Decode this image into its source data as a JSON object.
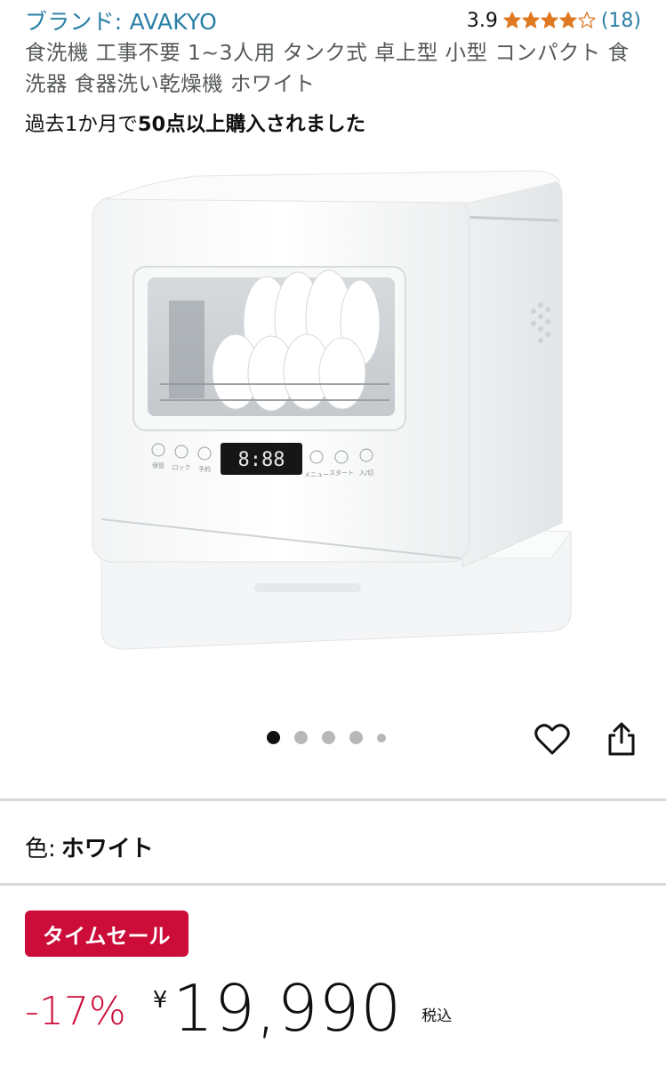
{
  "brand": {
    "link_text": "ブランド: AVAKYO"
  },
  "rating": {
    "value": "3.9",
    "stars_filled": 3.9,
    "stars_max": 5,
    "count_text": "(18)"
  },
  "product": {
    "title": "食洗機 工事不要 1~3人用 タンク式 卓上型 小型 コンパクト 食洗器 食器洗い乾燥機 ホワイト",
    "bought_prefix": "過去1か月で",
    "bought_emph": "50点以上購入されました"
  },
  "gallery": {
    "count": 5,
    "active_index": 0
  },
  "dishwasher_panel": {
    "display": "8:88",
    "buttons": [
      "保管",
      "ロック",
      "予約",
      "メニュー",
      "スタート一時停止",
      "入/切"
    ]
  },
  "actions": {
    "favorite_icon": "heart-icon",
    "share_icon": "share-icon"
  },
  "variant": {
    "label": "色:",
    "value": "ホワイト"
  },
  "deal": {
    "badge": "タイムセール"
  },
  "price": {
    "discount": "-17%",
    "currency": "¥",
    "amount": "19,990",
    "tax_note": "税込"
  },
  "colors": {
    "link": "#2a7fa6",
    "star": "#de7921",
    "deal_red": "#cc0c39",
    "divider": "#d5d9d9"
  }
}
